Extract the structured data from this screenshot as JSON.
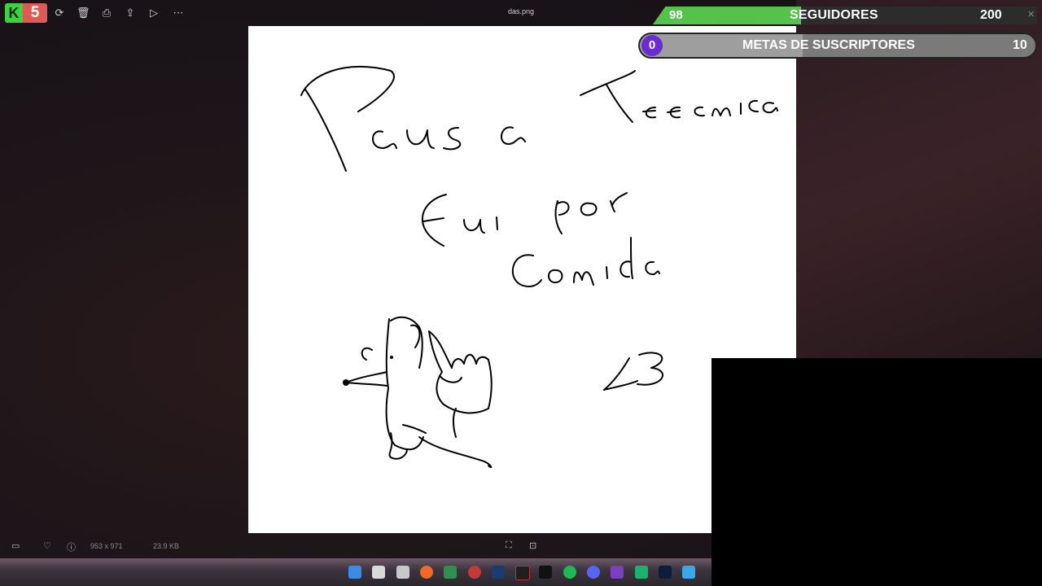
{
  "app": {
    "logo_letter": "K",
    "logo_number": "5",
    "file_name": "das.png"
  },
  "toolbar": {
    "icons": [
      "rotate-icon",
      "delete-icon",
      "print-icon",
      "share-icon",
      "slideshow-icon",
      "more-icon"
    ]
  },
  "overlay": {
    "followers_count": "98",
    "followers_label": "SEGUIDORES",
    "followers_goal": "200",
    "subs_count": "0",
    "subs_label": "METAS DE SUSCRIPTORES",
    "subs_goal": "10"
  },
  "image_text": {
    "line1": "Pausa Tecnica",
    "line2": "Fui por",
    "line3": "Comida",
    "note": "<3"
  },
  "status": {
    "dimensions": "953 x 971",
    "file_size": "23.9 KB"
  },
  "colors": {
    "green": "#56c24e",
    "purple": "#6a2bd0",
    "logo_green": "#3fd13f",
    "logo_red": "#e05a55"
  }
}
